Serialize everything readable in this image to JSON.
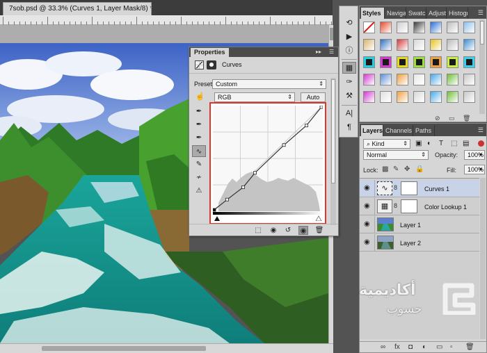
{
  "document": {
    "tab_title": "7sob.psd @ 33.3% (Curves 1, Layer Mask/8) *",
    "close_glyph": "×"
  },
  "properties": {
    "tab_label": "Properties",
    "header_title": "Curves",
    "preset_label": "Preset:",
    "preset_value": "Custom",
    "channel_value": "RGB",
    "auto_label": "Auto",
    "tools": [
      "pointer-hand",
      "eyedropper-black",
      "eyedropper-gray",
      "eyedropper-white",
      "curve-point",
      "pencil",
      "smooth",
      "clipping-warning"
    ],
    "curve_points": [
      [
        0,
        0
      ],
      [
        0.12,
        0.1
      ],
      [
        0.27,
        0.22
      ],
      [
        0.38,
        0.36
      ],
      [
        0.65,
        0.63
      ],
      [
        0.86,
        0.82
      ],
      [
        1,
        1
      ]
    ]
  },
  "styles": {
    "tabs": [
      "Styles",
      "Naviga",
      "Swatch",
      "Adjust",
      "Histogr"
    ],
    "active_tab": "Styles"
  },
  "layers": {
    "tabs": [
      "Layers",
      "Channels",
      "Paths"
    ],
    "active_tab": "Layers",
    "kind_label": "Kind",
    "blend_mode": "Normal",
    "opacity_label": "Opacity:",
    "opacity_value": "100%",
    "lock_label": "Lock:",
    "fill_label": "Fill:",
    "fill_value": "100%",
    "items": [
      {
        "name": "Curves 1",
        "type": "curves-adjustment",
        "visible": true,
        "selected": true
      },
      {
        "name": "Color Lookup 1",
        "type": "color-lookup-adjustment",
        "visible": true,
        "selected": false
      },
      {
        "name": "Layer 1",
        "type": "pixel",
        "visible": true,
        "selected": false
      },
      {
        "name": "Layer 2",
        "type": "pixel",
        "visible": true,
        "selected": false
      }
    ]
  },
  "watermark": {
    "text": "أكاديمية",
    "sub": "حسوب"
  },
  "colors": {
    "highlight_border": "#e0352b",
    "selected_row": "#c8d3e8",
    "panel_bg": "#d6d6d6",
    "ui_dark": "#535353"
  }
}
